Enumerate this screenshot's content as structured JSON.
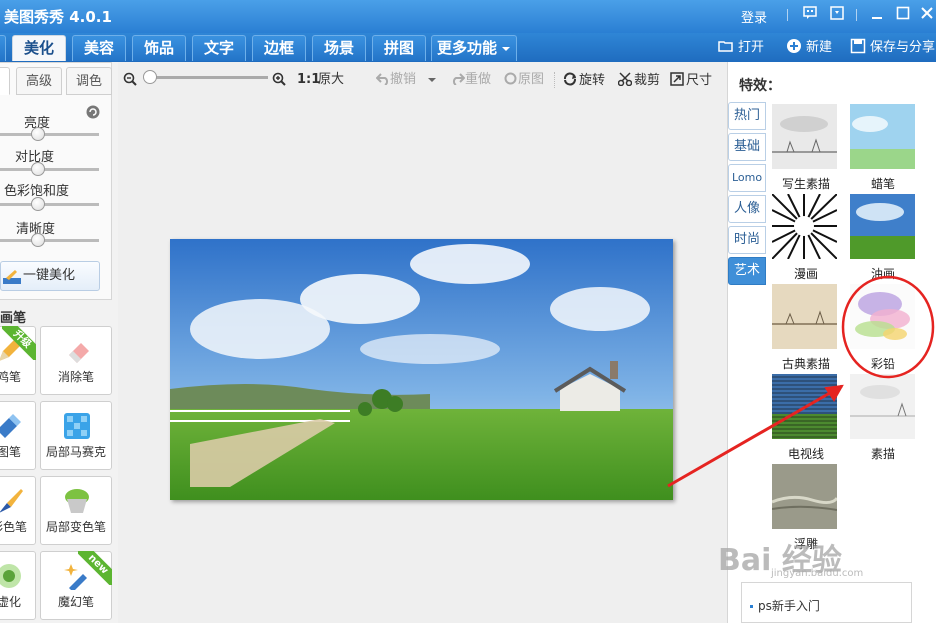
{
  "window": {
    "title": "美图秀秀 4.0.1",
    "login_label": "登录",
    "controls": [
      "message-icon",
      "skin-icon",
      "minimize-icon",
      "maximize-icon",
      "close-icon"
    ]
  },
  "tabs": [
    {
      "label": "美化",
      "active": true
    },
    {
      "label": "美容"
    },
    {
      "label": "饰品"
    },
    {
      "label": "文字"
    },
    {
      "label": "边框"
    },
    {
      "label": "场景"
    },
    {
      "label": "拼图"
    },
    {
      "label": "更多功能"
    }
  ],
  "top_actions": {
    "open_label": "打开",
    "new_label": "新建",
    "save_label": "保存与分享"
  },
  "left_panel": {
    "tabs": [
      "高级",
      "调色"
    ],
    "sliders": [
      {
        "label": "亮度",
        "value": 0.38
      },
      {
        "label": "对比度",
        "value": 0.38
      },
      {
        "label": "色彩饱和度",
        "value": 0.38
      },
      {
        "label": "清晰度",
        "value": 0.38
      }
    ],
    "one_key_label": "一键美化",
    "brush_section_label": "画笔",
    "brushes": [
      {
        "label": "鸡笔",
        "badge": "升级",
        "icon": "pencil-icon"
      },
      {
        "label": "消除笔",
        "icon": "eraser-icon"
      },
      {
        "label": "图笔",
        "icon": "pen-icon"
      },
      {
        "label": "局部马赛克",
        "icon": "mosaic-icon"
      },
      {
        "label": "彩色笔",
        "icon": "paintbrush-icon"
      },
      {
        "label": "局部变色笔",
        "icon": "paint-bucket-icon"
      },
      {
        "label": "虚化",
        "icon": "blur-icon"
      },
      {
        "label": "魔幻笔",
        "badge": "new",
        "icon": "magic-wand-icon"
      }
    ]
  },
  "canvas_toolbar": {
    "actual_size_label": "1:1",
    "original_size_label": "原大",
    "undo_label": "撤销",
    "redo_label": "重做",
    "original_label": "原图",
    "rotate_label": "旋转",
    "crop_label": "裁剪",
    "size_label": "尺寸",
    "zoom_level": 0.0
  },
  "effects_panel": {
    "title": "特效：",
    "categories": [
      {
        "label": "热门"
      },
      {
        "label": "基础"
      },
      {
        "label": "Lomo"
      },
      {
        "label": "人像"
      },
      {
        "label": "时尚"
      },
      {
        "label": "艺术",
        "active": true
      }
    ],
    "effects": [
      {
        "label": "写生素描"
      },
      {
        "label": "蜡笔"
      },
      {
        "label": "漫画"
      },
      {
        "label": "油画"
      },
      {
        "label": "古典素描"
      },
      {
        "label": "彩铅",
        "highlighted": true
      },
      {
        "label": "电视线"
      },
      {
        "label": "素描"
      },
      {
        "label": "浮雕"
      }
    ],
    "help_item": "ps新手入门"
  },
  "watermark": {
    "text": "Bai 经验",
    "sub": "jingyan.baidu.com"
  },
  "colors": {
    "titlebar": "#2a7fd3",
    "active_tab": "#3f8fd8",
    "annotation": "#e52421"
  }
}
